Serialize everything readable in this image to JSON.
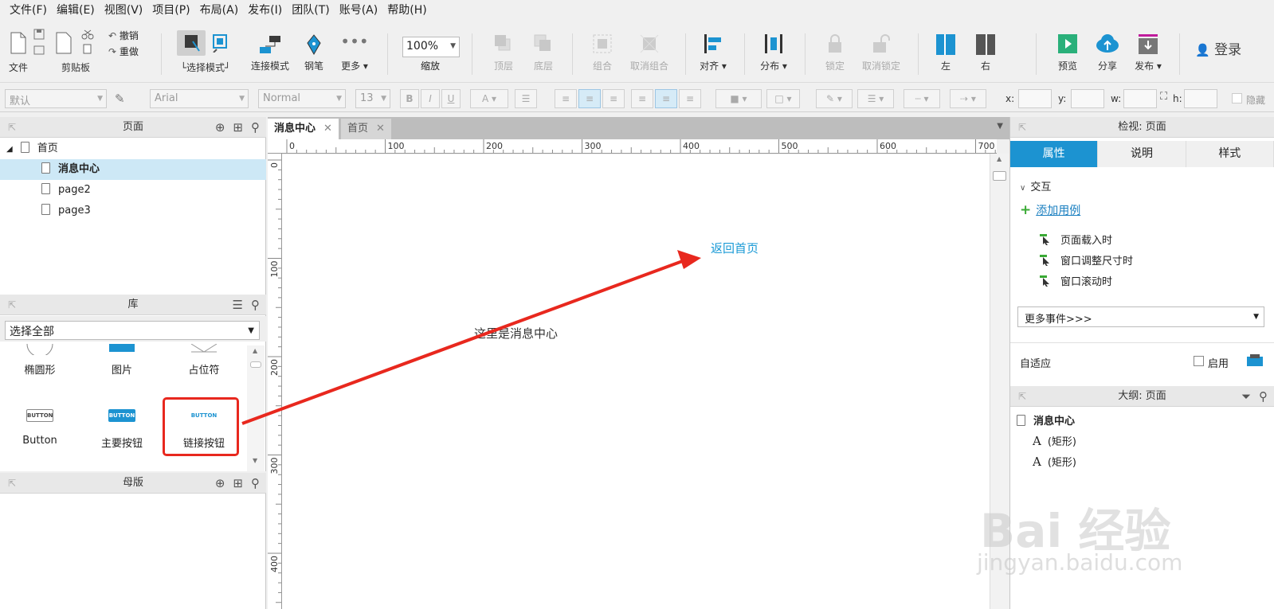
{
  "menu": [
    "文件(F)",
    "编辑(E)",
    "视图(V)",
    "项目(P)",
    "布局(A)",
    "发布(I)",
    "团队(T)",
    "账号(A)",
    "帮助(H)"
  ],
  "toolbar": {
    "file": "文件",
    "clipboard": "剪贴板",
    "undo": "撤销",
    "redo": "重做",
    "select_mode": "└选择模式┘",
    "connect_mode": "连接模式",
    "pen": "钢笔",
    "more": "更多 ▾",
    "zoom_value": "100%",
    "zoom": "缩放",
    "top_layer": "顶层",
    "bottom_layer": "底层",
    "group": "组合",
    "ungroup": "取消组合",
    "align": "对齐 ▾",
    "distribute": "分布 ▾",
    "lock": "锁定",
    "unlock": "取消锁定",
    "left": "左",
    "right": "右",
    "preview": "预览",
    "share": "分享",
    "publish": "发布 ▾",
    "login": "登录"
  },
  "format": {
    "style": "默认",
    "font": "Arial",
    "weight": "Normal",
    "size": "13",
    "bold": "B",
    "italic": "I",
    "underline": "U",
    "x_label": "x:",
    "y_label": "y:",
    "w_label": "w:",
    "h_label": "h:",
    "hidden": "隐藏"
  },
  "pages_panel": {
    "title": "页面",
    "items": [
      {
        "label": "首页",
        "level": 0
      },
      {
        "label": "消息中心",
        "level": 1,
        "selected": true
      },
      {
        "label": "page2",
        "level": 1
      },
      {
        "label": "page3",
        "level": 1
      }
    ]
  },
  "library_panel": {
    "title": "库",
    "select": "选择全部",
    "widgets": [
      {
        "label": "椭圆形"
      },
      {
        "label": "图片"
      },
      {
        "label": "占位符"
      },
      {
        "label": "Button",
        "text": "BUTTON"
      },
      {
        "label": "主要按钮",
        "text": "BUTTON"
      },
      {
        "label": "链接按钮",
        "text": "BUTTON"
      }
    ]
  },
  "masters_panel": {
    "title": "母版"
  },
  "tabs": [
    {
      "label": "消息中心",
      "active": true
    },
    {
      "label": "首页",
      "active": false
    }
  ],
  "ruler": {
    "h": [
      "0",
      "100",
      "200",
      "300",
      "400",
      "500",
      "600",
      "700"
    ],
    "v": [
      "0",
      "100",
      "200",
      "300",
      "400"
    ]
  },
  "canvas": {
    "text1": "这里是消息中心",
    "link": "返回首页"
  },
  "inspector": {
    "title": "检视: 页面",
    "tabs": [
      "属性",
      "说明",
      "样式"
    ],
    "interaction": "交互",
    "add_case": "添加用例",
    "events": [
      "页面载入时",
      "窗口调整尺寸时",
      "窗口滚动时"
    ],
    "more_events": "更多事件>>>",
    "adaptive": "自适应",
    "enable": "启用"
  },
  "outline": {
    "title": "大纲: 页面",
    "root": "消息中心",
    "items": [
      "(矩形)",
      "(矩形)"
    ]
  },
  "watermark": {
    "brand": "Bai 经验",
    "url": "jingyan.baidu.com"
  },
  "colors": {
    "accent": "#1c93d1",
    "link": "#1a9ad6",
    "annotation": "#e8281e"
  }
}
